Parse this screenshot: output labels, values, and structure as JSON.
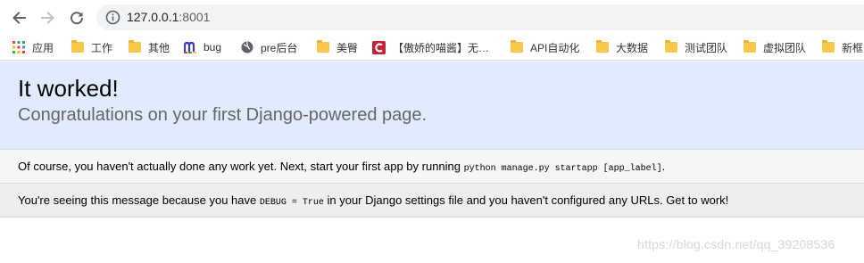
{
  "browser": {
    "address": {
      "host": "127.0.0.1",
      "port": ":8001"
    },
    "icons": {
      "back": "arrow-left-icon",
      "forward": "arrow-right-icon",
      "reload": "reload-icon",
      "site_info": "info-circle-icon"
    }
  },
  "bookmarks": [
    {
      "label": "应用",
      "icon": "apps-grid-icon"
    },
    {
      "label": "工作",
      "icon": "folder-icon"
    },
    {
      "label": "其他",
      "icon": "folder-icon"
    },
    {
      "label": "bug",
      "icon": "m-logo-icon"
    },
    {
      "label": "pre后台",
      "icon": "globe-icon"
    },
    {
      "label": "美臀",
      "icon": "folder-icon"
    },
    {
      "label": "【傲娇的喵酱】无…",
      "icon": "csdn-logo-icon"
    },
    {
      "label": "API自动化",
      "icon": "folder-icon"
    },
    {
      "label": "大数据",
      "icon": "folder-icon"
    },
    {
      "label": "测试团队",
      "icon": "folder-icon"
    },
    {
      "label": "虚拟团队",
      "icon": "folder-icon"
    },
    {
      "label": "新框",
      "icon": "folder-icon"
    }
  ],
  "page": {
    "title": "It worked!",
    "subtitle": "Congratulations on your first Django-powered page.",
    "instructions": {
      "before": "Of course, you haven't actually done any work yet. Next, start your first app by running ",
      "code": "python manage.py startapp [app_label]",
      "after": "."
    },
    "explanation": {
      "before": "You're seeing this message because you have ",
      "code": "DEBUG = True",
      "after": " in your Django settings file and you haven't configured any URLs. Get to work!"
    }
  },
  "watermark": "https://blog.csdn.net/qq_39208536",
  "colors": {
    "summary_bg": "#e0ebff",
    "instructions_bg": "#f6f6f6",
    "explanation_bg": "#eeeeee",
    "folder": "#f6c94d"
  }
}
